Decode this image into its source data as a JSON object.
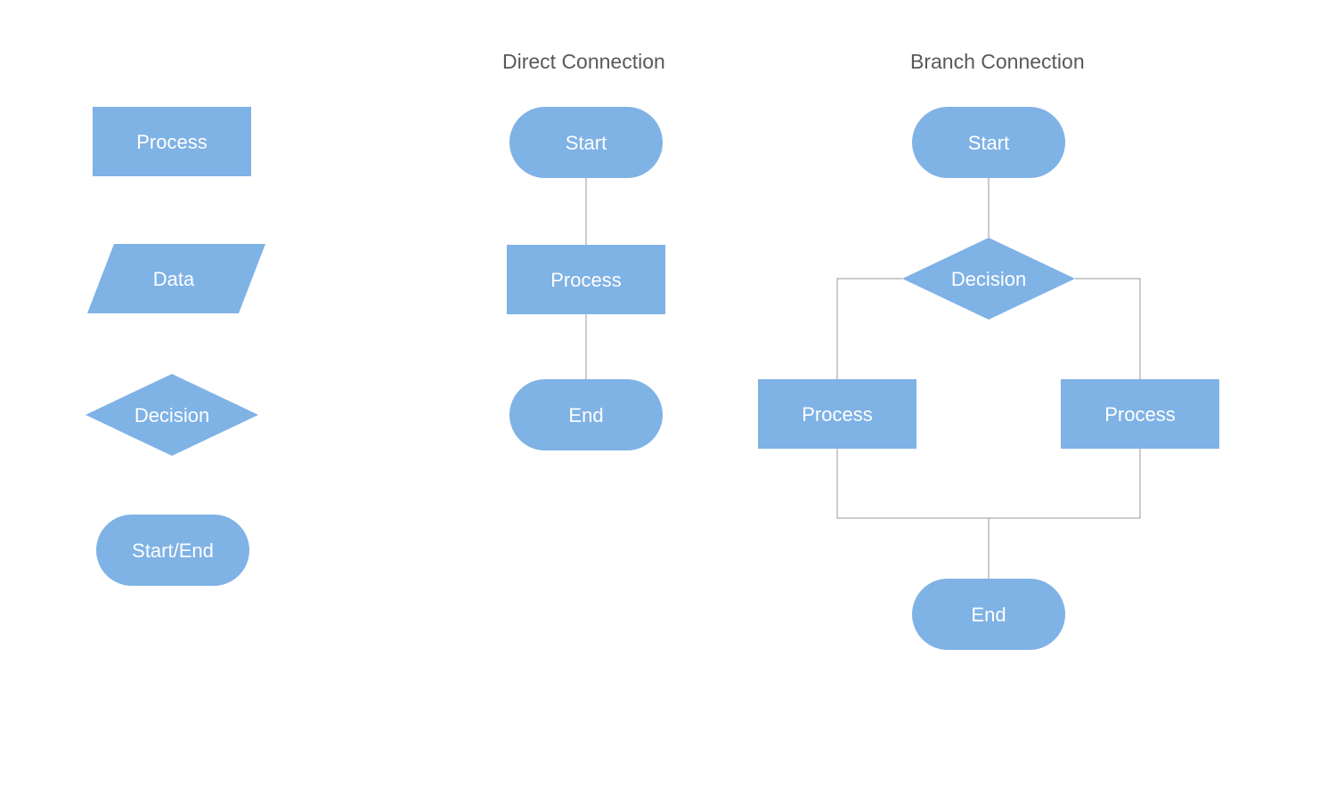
{
  "headings": {
    "direct": "Direct Connection",
    "branch": "Branch Connection"
  },
  "legend": {
    "process": "Process",
    "data": "Data",
    "decision": "Decision",
    "terminator": "Start/End"
  },
  "direct": {
    "start": "Start",
    "process": "Process",
    "end": "End"
  },
  "branch": {
    "start": "Start",
    "decision": "Decision",
    "processLeft": "Process",
    "processRight": "Process",
    "end": "End"
  },
  "colors": {
    "shapeFill": "#7fb2e5",
    "connector": "#999999",
    "heading": "#595959"
  }
}
